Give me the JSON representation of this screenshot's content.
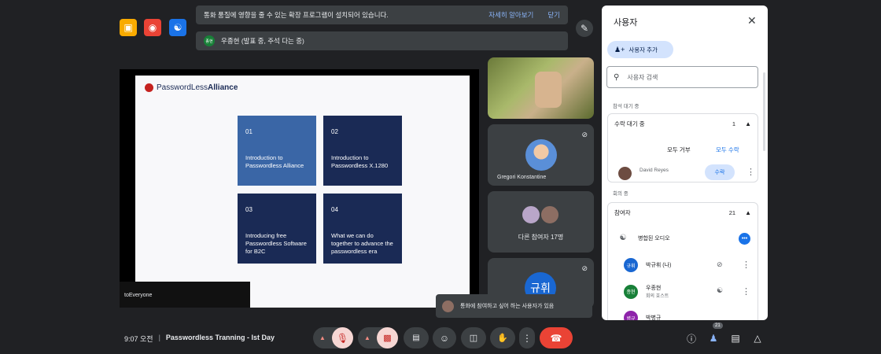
{
  "banner": {
    "message": "통화 품질에 영향을 줄 수 있는 확장 프로그램이 설치되어 있습니다.",
    "learn_more": "자세히 알아보기",
    "close": "닫기"
  },
  "presenter_banner": {
    "initials": "종현",
    "text": "우종현 (발표 중, 주석 다는 중)"
  },
  "slide": {
    "logo_light": "PasswordLess",
    "logo_bold": "Alliance",
    "boxes": [
      {
        "num": "01",
        "text": "Introduction to Passwordless Alliance"
      },
      {
        "num": "02",
        "text": "Introduction to Passwordless X.1280"
      },
      {
        "num": "03",
        "text": "Introducing free Passwordless Software for B2C"
      },
      {
        "num": "04",
        "text": "What we can do together to advance the passwordless era"
      }
    ],
    "chat_overlay": "toEveryone"
  },
  "tiles": {
    "tile2_name": "Gregori Konstantine",
    "others_label": "다른 참여자 17명",
    "self_initials": "규휘"
  },
  "toast": "통화에 참여하고 싶어 하는 사용자가 있음",
  "bottom": {
    "time": "9:07 오전",
    "separator": "|",
    "meeting_name": "Passwordless Tranning - Ist Day",
    "participant_badge": "21"
  },
  "panel": {
    "title": "사용자",
    "add_people": "사용자 추가",
    "search_placeholder": "사용자 검색",
    "waiting_section": "참석 대기 중",
    "waiting_card": {
      "title": "수락 대기 중",
      "count": "1",
      "deny_all": "모두 거부",
      "admit_all": "모두 수락",
      "person_name": "David Reyes",
      "admit": "수락"
    },
    "in_call_section": "회의 중",
    "participants_card": {
      "title": "참여자",
      "count": "21",
      "merged_audio": "병합된 오디오",
      "people": [
        {
          "initials": "규휘",
          "name": "박규휘 (나)",
          "sub": ""
        },
        {
          "initials": "종현",
          "name": "우종현",
          "sub": "회의 호스트"
        },
        {
          "initials": "병규",
          "name": "박병규",
          "sub": ""
        }
      ]
    }
  },
  "colors": {
    "accent": "#1a73e8",
    "slide_blue": "#3a66a6",
    "slide_navy": "#1a2a55",
    "end_call": "#ea4335"
  }
}
